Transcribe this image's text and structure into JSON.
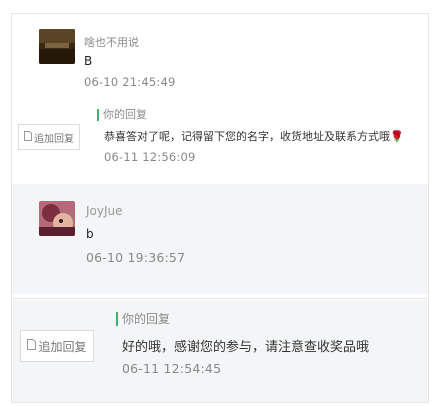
{
  "comments": [
    {
      "user": "啥也不用说",
      "message": "B",
      "time": "06-10 21:45:49",
      "reply": {
        "label": "你的回复",
        "text": "恭喜答对了呢，记得留下您的名字，收货地址及联系方式哦🌹",
        "time": "06-11 12:56:09",
        "add_button": "追加回复"
      }
    },
    {
      "user": "JoyJue",
      "message": "b",
      "time": "06-10 19:36:57",
      "reply": {
        "label": "你的回复",
        "text": "好的哦，感谢您的参与，请注意查收奖品哦",
        "time": "06-11 12:54:45",
        "add_button": "追加回复"
      }
    }
  ],
  "icons": {
    "add_button_icon": "document-icon",
    "reply_marker": "green-bar"
  },
  "colors": {
    "reply_bar": "#3cb371",
    "gray_bg": "#f4f5f6"
  }
}
